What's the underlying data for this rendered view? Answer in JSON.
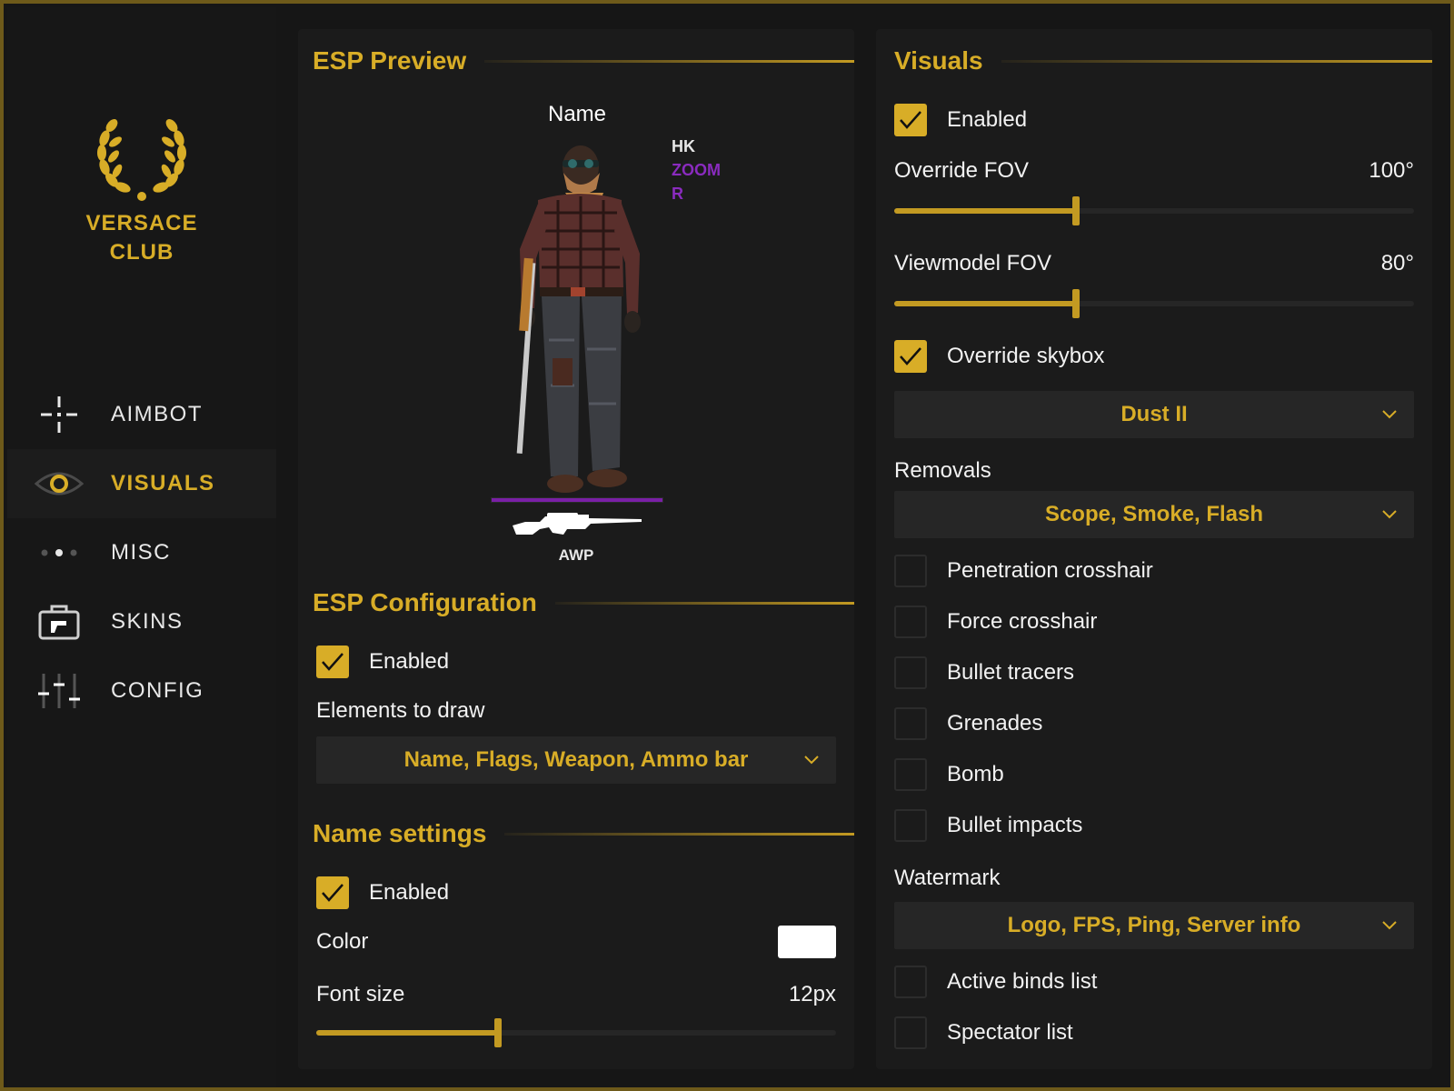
{
  "brand": {
    "line1": "VERSACE",
    "line2": "CLUB"
  },
  "nav": [
    {
      "label": "AIMBOT",
      "icon": "crosshair-icon",
      "active": false
    },
    {
      "label": "VISUALS",
      "icon": "eye-icon",
      "active": true
    },
    {
      "label": "MISC",
      "icon": "dots-icon",
      "active": false
    },
    {
      "label": "SKINS",
      "icon": "gun-case-icon",
      "active": false
    },
    {
      "label": "CONFIG",
      "icon": "sliders-icon",
      "active": false
    }
  ],
  "left": {
    "preview_title": "ESP Preview",
    "preview": {
      "name": "Name",
      "flags": [
        {
          "text": "HK",
          "color": "#e6e6e6"
        },
        {
          "text": "ZOOM",
          "color": "#8a2bbf"
        },
        {
          "text": "R",
          "color": "#8a2bbf"
        }
      ],
      "weapon": "AWP",
      "ammo_fraction": 1.0
    },
    "config_title": "ESP Configuration",
    "config_enabled": {
      "label": "Enabled",
      "checked": true
    },
    "elements_label": "Elements to draw",
    "elements_value": "Name, Flags, Weapon, Ammo bar",
    "name_title": "Name settings",
    "name_enabled": {
      "label": "Enabled",
      "checked": true
    },
    "color_label": "Color",
    "color_value": "#ffffff",
    "font_size_label": "Font size",
    "font_size_value": "12px",
    "font_size_fraction": 0.35
  },
  "right": {
    "title": "Visuals",
    "enabled": {
      "label": "Enabled",
      "checked": true
    },
    "override_fov": {
      "label": "Override FOV",
      "value": "100°",
      "fraction": 0.35
    },
    "viewmodel_fov": {
      "label": "Viewmodel FOV",
      "value": "80°",
      "fraction": 0.35
    },
    "override_skybox": {
      "label": "Override skybox",
      "checked": true
    },
    "skybox_value": "Dust II",
    "removals_label": "Removals",
    "removals_value": "Scope, Smoke, Flash",
    "checkboxes": [
      {
        "label": "Penetration crosshair",
        "checked": false
      },
      {
        "label": "Force crosshair",
        "checked": false
      },
      {
        "label": "Bullet tracers",
        "checked": false
      },
      {
        "label": "Grenades",
        "checked": false
      },
      {
        "label": "Bomb",
        "checked": false
      },
      {
        "label": "Bullet impacts",
        "checked": false
      }
    ],
    "watermark_label": "Watermark",
    "watermark_value": "Logo, FPS, Ping, Server info",
    "bottom_checkboxes": [
      {
        "label": "Active binds list",
        "checked": false
      },
      {
        "label": "Spectator list",
        "checked": false
      }
    ]
  },
  "colors": {
    "accent": "#d8ad27",
    "panel": "#1b1b1b",
    "control": "#262626",
    "purple": "#8a2bbf"
  }
}
